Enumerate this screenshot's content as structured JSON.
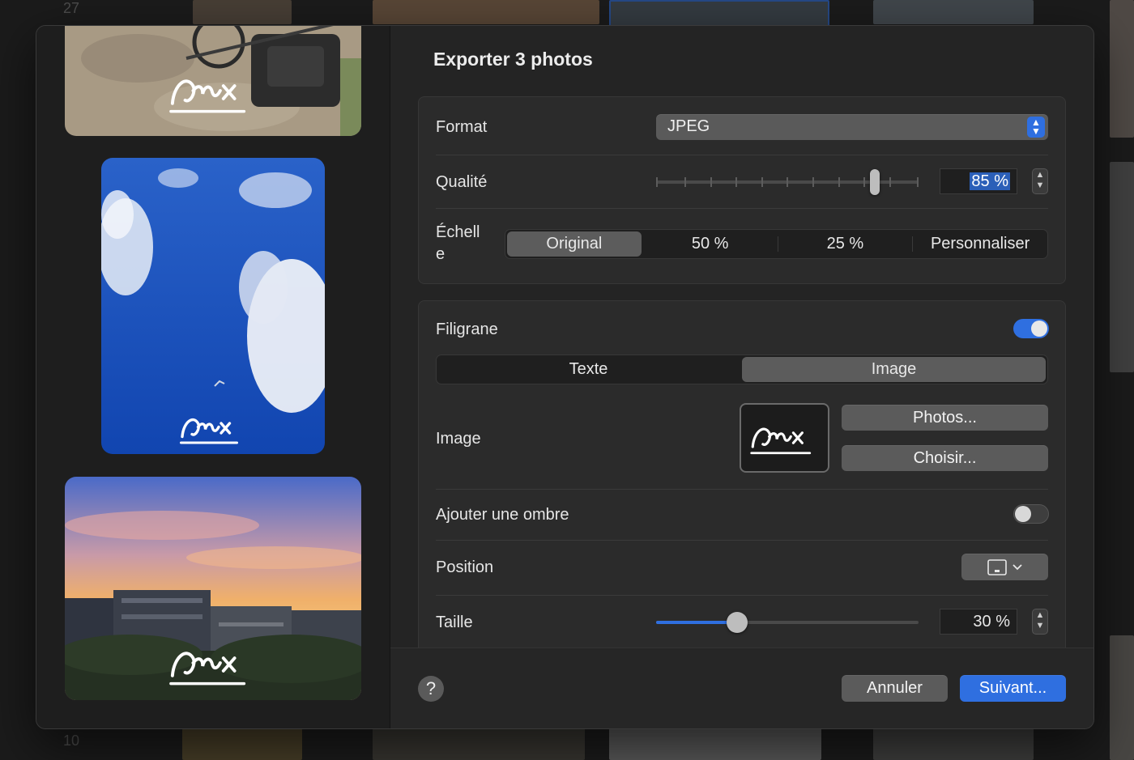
{
  "background": {
    "row_numbers": [
      "27",
      "10"
    ]
  },
  "dialog": {
    "title": "Exporter 3 photos",
    "format": {
      "label": "Format",
      "value": "JPEG"
    },
    "quality": {
      "label": "Qualité",
      "value": "85 %",
      "level": 0.85
    },
    "scale": {
      "label": "Échell e",
      "label_lines": [
        "Échell",
        "e"
      ],
      "options": [
        "Original",
        "50 %",
        "25 %",
        "Personnaliser"
      ],
      "selected": "Original"
    },
    "watermark": {
      "label": "Filigrane",
      "enabled": true,
      "type_options": [
        "Texte",
        "Image"
      ],
      "type_selected": "Image",
      "image_label": "Image",
      "photos_button": "Photos...",
      "choose_button": "Choisir...",
      "shadow_label": "Ajouter une ombre",
      "shadow_enabled": false,
      "position_label": "Position",
      "size_label": "Taille",
      "size_value": "30 %",
      "size_level": 0.3
    },
    "footer": {
      "help": "?",
      "cancel": "Annuler",
      "next": "Suivant..."
    }
  },
  "colors": {
    "accent": "#2f6fe0",
    "dialog_bg": "#242424",
    "group_bg": "#2b2b2b"
  },
  "icons": [
    "chevron-up-down-icon",
    "help-icon",
    "position-icon",
    "chevron-down-icon",
    "signature-watermark-icon"
  ]
}
